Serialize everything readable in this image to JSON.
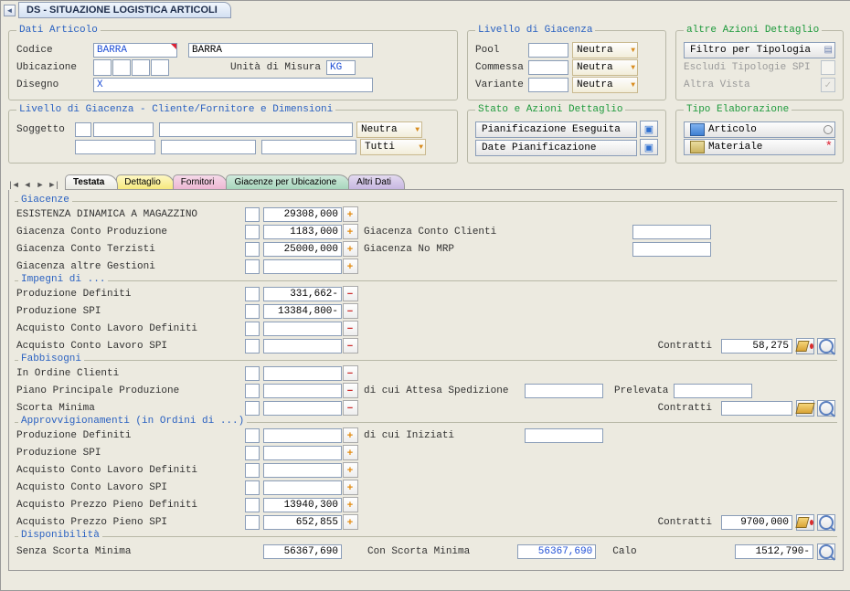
{
  "title": "DS - SITUAZIONE LOGISTICA ARTICOLI",
  "datiArticolo": {
    "legend": "Dati Articolo",
    "codice_lbl": "Codice",
    "codice_val": "BARRA",
    "codice_desc": "BARRA",
    "ubic_lbl": "Ubicazione",
    "um_lbl": "Unità di Misura",
    "um_val": "KG",
    "dis_lbl": "Disegno",
    "dis_val": "X"
  },
  "livGiac": {
    "legend": "Livello di Giacenza",
    "pool": "Pool",
    "commessa": "Commessa",
    "variante": "Variante",
    "neutra": "Neutra"
  },
  "altre": {
    "legend": "altre Azioni Dettaglio",
    "filtro": "Filtro per Tipologia",
    "escludi": "Escludi Tipologie SPI",
    "altra": "Altra Vista"
  },
  "livCliFor": {
    "legend": "Livello di Giacenza - Cliente/Fornitore e Dimensioni",
    "sogg": "Soggetto",
    "neutra": "Neutra",
    "tutti": "Tutti"
  },
  "stato": {
    "legend": "Stato e Azioni Dettaglio",
    "pian": "Pianificazione Eseguita",
    "date": "Date Pianificazione"
  },
  "tipo": {
    "legend": "Tipo Elaborazione",
    "art": "Articolo",
    "mat": "Materiale"
  },
  "tabs": {
    "t0": "Testata",
    "t1": "Dettaglio",
    "t2": "Fornitori",
    "t3": "Giacenze per Ubicazione",
    "t4": "Altri Dati"
  },
  "giac": {
    "legend": "Giacenze",
    "r1": "ESISTENZA DINAMICA A MAGAZZINO",
    "v1": "29308,000",
    "r2": "Giacenza Conto Produzione",
    "v2": "1183,000",
    "r2b": "Giacenza Conto Clienti",
    "r3": "Giacenza Conto Terzisti",
    "v3": "25000,000",
    "r3b": "Giacenza No MRP",
    "r4": "Giacenza altre Gestioni"
  },
  "imp": {
    "legend": "Impegni di ...",
    "r1": "Produzione Definiti",
    "v1": "331,662-",
    "r2": "Produzione SPI",
    "v2": "13384,800-",
    "r3": "Acquisto Conto Lavoro Definiti",
    "r4": "Acquisto Conto Lavoro SPI",
    "contr": "Contratti",
    "contr_v": "58,275"
  },
  "fab": {
    "legend": "Fabbisogni",
    "r1": "In Ordine Clienti",
    "r2": "Piano Principale Produzione",
    "r2b": "di cui Attesa Spedizione",
    "r2c": "Prelevata",
    "r3": "Scorta Minima",
    "contr": "Contratti"
  },
  "appr": {
    "legend": "Approvvigionamenti (in Ordini di ...)",
    "r1": "Produzione Definiti",
    "r1b": "di cui Iniziati",
    "r2": "Produzione SPI",
    "r3": "Acquisto Conto Lavoro Definiti",
    "r4": "Acquisto Conto Lavoro SPI",
    "r5": "Acquisto Prezzo Pieno Definiti",
    "v5": "13940,300",
    "r6": "Acquisto Prezzo Pieno SPI",
    "v6": "652,855",
    "contr": "Contratti",
    "contr_v": "9700,000"
  },
  "disp": {
    "legend": "Disponibilità",
    "r1": "Senza Scorta Minima",
    "v1": "56367,690",
    "r2": "Con Scorta Minima",
    "v2": "56367,690",
    "r3": "Calo",
    "v3": "1512,790-"
  }
}
